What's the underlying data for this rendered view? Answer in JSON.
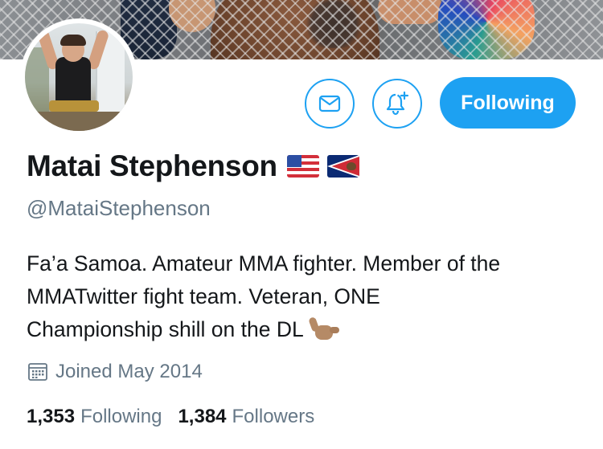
{
  "profile": {
    "name": "Matai Stephenson",
    "handle": "@MataiStephenson",
    "flags": [
      "us-flag-icon",
      "american-samoa-flag-icon"
    ],
    "bio_lines": [
      "Fa’a Samoa. Amateur MMA fighter. Member of the",
      "MMATwitter fight team. Veteran, ONE",
      "Championship shill on the DL"
    ],
    "bio_emoji": "call-me-hand-icon",
    "joined": "Joined May 2014"
  },
  "actions": {
    "message_icon": "envelope-icon",
    "notify_icon": "bell-plus-icon",
    "follow_label": "Following"
  },
  "stats": {
    "following_count": "1,353",
    "following_label": "Following",
    "followers_count": "1,384",
    "followers_label": "Followers"
  },
  "colors": {
    "accent": "#1da1f2",
    "text_primary": "#14171a",
    "text_secondary": "#657786"
  }
}
